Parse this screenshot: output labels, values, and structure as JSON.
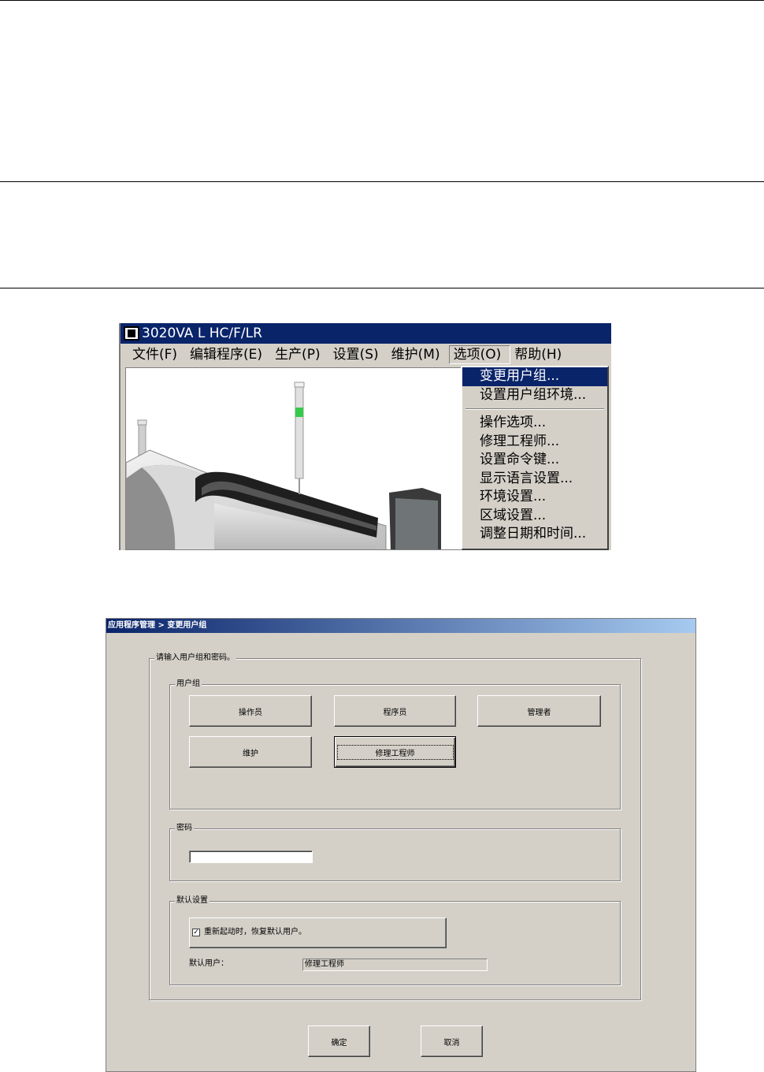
{
  "app_window": {
    "title": "3020VA L HC/F/LR",
    "menubar": [
      "文件(F)",
      "编辑程序(E)",
      "生产(P)",
      "设置(S)",
      "维护(M)",
      "选项(O)",
      "帮助(H)"
    ],
    "open_menu": "选项(O)",
    "options_menu": {
      "group1": [
        "变更用户组...",
        "设置用户组环境..."
      ],
      "group2": [
        "操作选项...",
        "修理工程师...",
        "设置命令键...",
        "显示语言设置...",
        "环境设置...",
        "区域设置...",
        "调整日期和时间..."
      ]
    }
  },
  "dialog": {
    "title": "应用程序管理 > 变更用户组",
    "prompt_group": "请输入用户组和密码。",
    "user_group_label": "用户组",
    "user_groups": [
      "操作员",
      "程序员",
      "管理者",
      "维护",
      "修理工程师"
    ],
    "selected_group": "修理工程师",
    "password_label": "密码",
    "password_value": "",
    "default_settings_label": "默认设置",
    "restore_checkbox_label": "重新起动时，恢复默认用户。",
    "restore_checked": true,
    "default_user_label": "默认用户：",
    "default_user_value": "修理工程师",
    "ok_label": "确定",
    "cancel_label": "取消"
  },
  "colors": {
    "titlebar": "#0a246a",
    "face": "#d4d0c8",
    "indicator_green": "#35c94b"
  }
}
